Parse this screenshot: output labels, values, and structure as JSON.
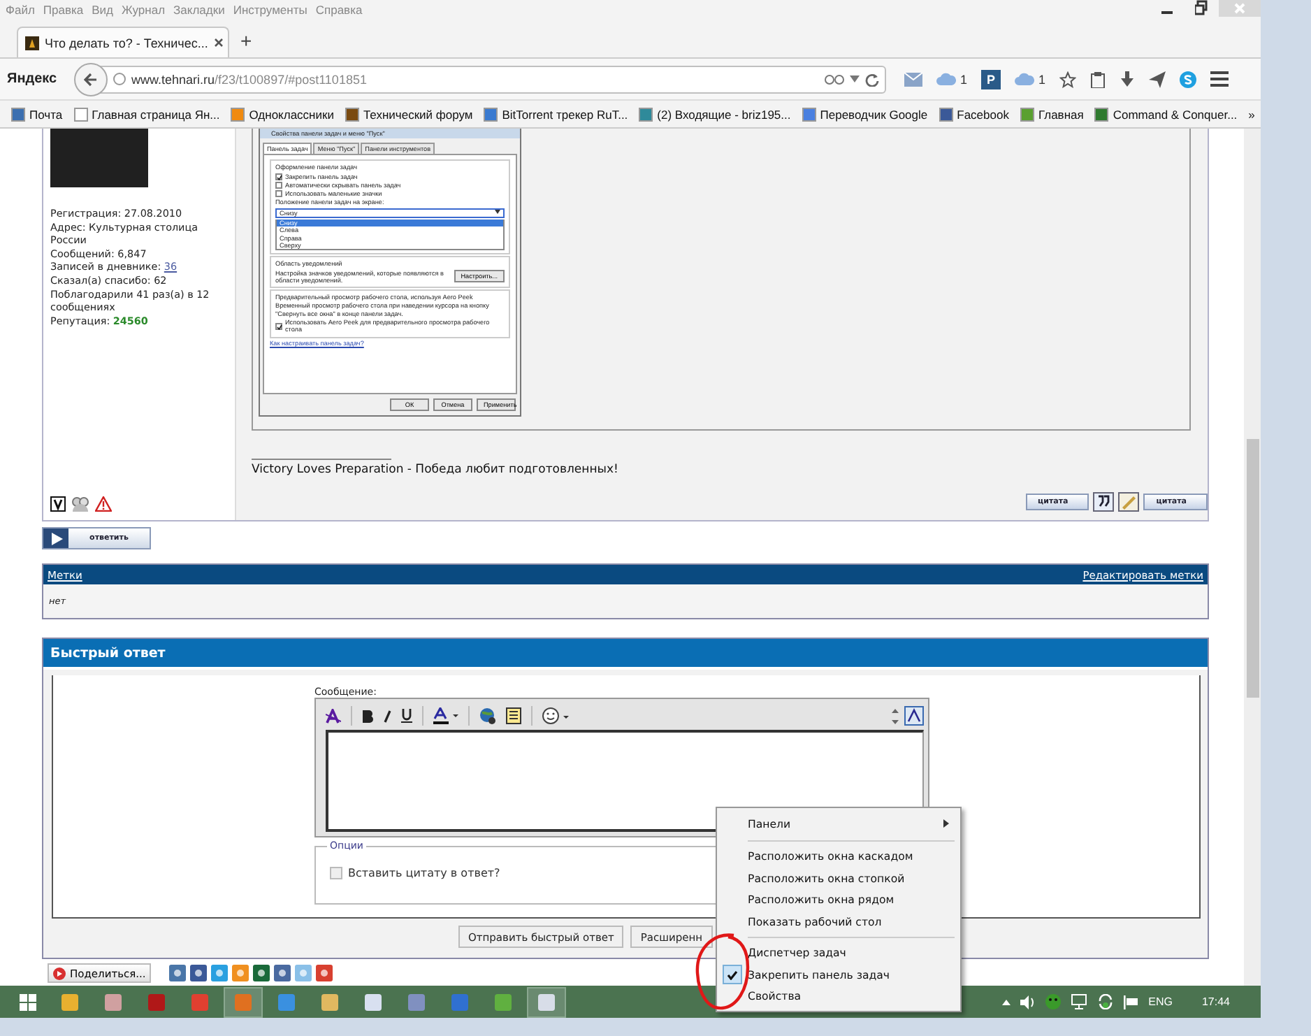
{
  "menu_bar": [
    "Файл",
    "Правка",
    "Вид",
    "Журнал",
    "Закладки",
    "Инструменты",
    "Справка"
  ],
  "tabs": [
    {
      "title": "Что делать то? - Техничес...",
      "selected": true
    }
  ],
  "new_tab": "+",
  "address_bar": {
    "brand": "Яндекс",
    "host": "www.tehnari.ru",
    "path": "/f23/t100897/#post1101851"
  },
  "toolbar": [
    {
      "kind": "mail"
    },
    {
      "kind": "cloud",
      "count": "1"
    },
    {
      "kind": "letter",
      "label": "P"
    },
    {
      "kind": "cloud",
      "count": "1"
    },
    {
      "kind": "star"
    },
    {
      "kind": "clipboard"
    },
    {
      "kind": "download"
    },
    {
      "kind": "send"
    },
    {
      "kind": "skype"
    },
    {
      "kind": "menu"
    }
  ],
  "bookmarks": [
    {
      "label": "Почта",
      "color": "#3b6fb0"
    },
    {
      "label": "Главная страница Ян...",
      "color": "#ffffff"
    },
    {
      "label": "Одноклассники",
      "color": "#f08a10"
    },
    {
      "label": "Технический форум",
      "color": "#7a4a10"
    },
    {
      "label": "BitTorrent трекер RuT...",
      "color": "#3a7ad0"
    },
    {
      "label": "(2) Входящие - briz195...",
      "color": "#2f8a9a"
    },
    {
      "label": "Переводчик Google",
      "color": "#4a80e0"
    },
    {
      "label": "Facebook",
      "color": "#3b5998"
    },
    {
      "label": "Главная",
      "color": "#5aa030"
    },
    {
      "label": "Command & Conquer...",
      "color": "#2f7a2f"
    }
  ],
  "bookmarks_more": "»",
  "post": {
    "user_info": [
      {
        "kind": "text",
        "label": "Регистрация: 27.08.2010"
      },
      {
        "kind": "text",
        "label": "Адрес: Культурная столица России"
      },
      {
        "kind": "text",
        "label": "Сообщений: 6,847"
      },
      {
        "kind": "link",
        "label": "Записей в дневнике: ",
        "value": "36"
      },
      {
        "kind": "text",
        "label": "Сказал(а) спасибо: 62"
      },
      {
        "kind": "text",
        "label": "Поблагодарили 41 раз(а) в 12 сообщениях"
      },
      {
        "kind": "reputation",
        "label": "Репутация: ",
        "value": "24560"
      }
    ],
    "dialog": {
      "title": "Свойства панели задач и меню \"Пуск\"",
      "tabs": [
        {
          "label": "Панель задач",
          "selected": true
        },
        {
          "label": "Меню \"Пуск\"",
          "selected": false
        },
        {
          "label": "Панели инструментов",
          "selected": false
        }
      ],
      "group_title": "Оформление панели задач",
      "checkboxes": [
        {
          "label": "Закрепить панель задач",
          "checked": true
        },
        {
          "label": "Автоматически скрывать панель задач",
          "checked": false
        },
        {
          "label": "Использовать маленькие значки",
          "checked": false
        }
      ],
      "position_label": "Положение панели задач на экране:",
      "position_value": "Снизу",
      "position_options": [
        {
          "label": "Снизу",
          "selected": true
        },
        {
          "label": "Слева",
          "selected": false
        },
        {
          "label": "Справа",
          "selected": false
        },
        {
          "label": "Сверху",
          "selected": false
        }
      ],
      "notify_title": "Область уведомлений",
      "notify_text": "Настройка значков уведомлений, которые появляются в области уведомлений.",
      "notify_button": "Настроить...",
      "peek_title": "Предварительный просмотр рабочего стола, используя Aero Peek",
      "peek_text": "Временный просмотр рабочего стола при наведении курсора на кнопку \"Свернуть все окна\" в конце панели задач.",
      "peek_checkbox": {
        "label": "Использовать Aero Peek для предварительного просмотра рабочего стола",
        "checked": true
      },
      "help_link": "Как настраивать панель задач?",
      "buttons": [
        "ОК",
        "Отмена",
        "Применить"
      ]
    },
    "signature": "Victory Loves Preparation - Победа любит подготовленных!",
    "quote_buttons": [
      "цитата",
      "цитата"
    ],
    "reply_button": "ответить"
  },
  "tags": {
    "title": "Метки",
    "edit_link": "Редактировать метки",
    "value": "нет"
  },
  "quick_reply": {
    "title": "Быстрый ответ",
    "message_label": "Сообщение:",
    "options_legend": "Опции",
    "quote_checkbox": {
      "label": "Вставить цитату в ответ?",
      "checked": false
    },
    "buttons": [
      "Отправить быстрый ответ",
      "Расширенн"
    ]
  },
  "share": {
    "label": "Поделиться..."
  },
  "taskbar": {
    "apps": [
      {
        "color": "#e8b030",
        "selected": false
      },
      {
        "color": "#d0a0a0",
        "selected": false
      },
      {
        "color": "#b01818",
        "selected": false
      },
      {
        "color": "#e04030",
        "selected": false
      },
      {
        "color": "#e07020",
        "selected": true
      },
      {
        "color": "#3a90e0",
        "selected": false
      },
      {
        "color": "#e0b860",
        "selected": false
      },
      {
        "color": "#d8e0f0",
        "selected": false
      },
      {
        "color": "#8090c0",
        "selected": false
      },
      {
        "color": "#3070d0",
        "selected": false
      },
      {
        "color": "#60b040",
        "selected": false
      },
      {
        "color": "#d8dde8",
        "selected": true
      }
    ],
    "language": "ENG",
    "time": "17:44"
  },
  "context_menu": [
    {
      "kind": "submenu",
      "label": "Панели"
    },
    {
      "kind": "separator"
    },
    {
      "kind": "item",
      "label": "Расположить окна каскадом",
      "checked": false
    },
    {
      "kind": "item",
      "label": "Расположить окна стопкой",
      "checked": false
    },
    {
      "kind": "item",
      "label": "Расположить окна рядом",
      "checked": false
    },
    {
      "kind": "item",
      "label": "Показать рабочий стол",
      "checked": false
    },
    {
      "kind": "separator"
    },
    {
      "kind": "item",
      "label": "Диспетчер задач",
      "checked": false
    },
    {
      "kind": "item",
      "label": "Закрепить панель задач",
      "checked": true
    },
    {
      "kind": "item",
      "label": "Свойства",
      "checked": false
    }
  ]
}
